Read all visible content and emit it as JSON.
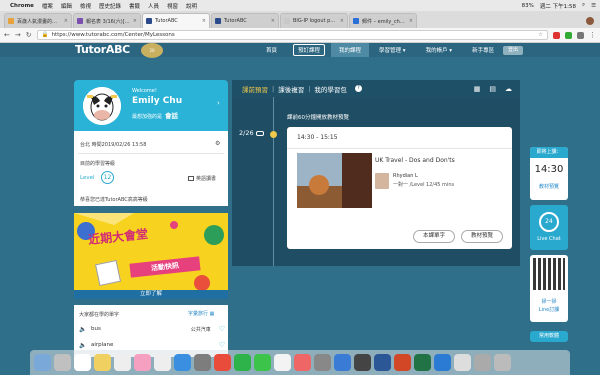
{
  "mac_menu": {
    "app": "Chrome",
    "items": [
      "檔案",
      "編輯",
      "檢視",
      "歷史記錄",
      "書籤",
      "人員",
      "視窗",
      "說明"
    ],
    "battery": "83%",
    "time": "週二 下午1:58"
  },
  "browser": {
    "tabs": [
      {
        "title": "百歲人氣漫畫的大崩拼：近",
        "color": "#e8a23c",
        "active": false
      },
      {
        "title": "報名表 3/16(六)[台北] 創心",
        "color": "#7a4fb0",
        "active": false
      },
      {
        "title": "TutorABC",
        "color": "#2a4a8c",
        "active": true
      },
      {
        "title": "TutorABC",
        "color": "#2a4a8c",
        "active": false
      },
      {
        "title": "BIG-IP logout page",
        "color": "#c8c8c8",
        "active": false
      },
      {
        "title": "郵件 – emily_chu@cathay",
        "color": "#2a6fd8",
        "active": false
      }
    ],
    "url": "https://www.tutorabc.com/Center/MyLessons"
  },
  "site": {
    "logo": "TutorABC",
    "nav": [
      {
        "label": "首頁",
        "style": "plain"
      },
      {
        "label": "預訂課程",
        "style": "boxed"
      },
      {
        "label": "我的課程",
        "style": "active"
      },
      {
        "label": "學習管理 ▾",
        "style": "plain"
      },
      {
        "label": "我的帳戶 ▾",
        "style": "plain"
      },
      {
        "label": "新手專區",
        "style": "plain"
      }
    ],
    "logout": "登出"
  },
  "profile": {
    "welcome": "Welcome!",
    "name": "Emily Chu",
    "fav_prefix": "最想加強的是",
    "fav_value": "會話",
    "time_zone": "台北 時間2019/02/26 13:58",
    "level_label_text": "目前的學習等級",
    "level_label": "Level",
    "level_value": "12",
    "english_test": "英語讀書",
    "congrats": "恭喜您已達TutorABC高高等級"
  },
  "banner": {
    "title": "近期大會堂",
    "subtitle": "活動快訊",
    "cta": "立即了解"
  },
  "vocab": {
    "title": "大家都在學的單字",
    "link": "字彙旅行",
    "words": [
      {
        "word": "bus",
        "translation": "公共汽車"
      },
      {
        "word": "airplane",
        "translation": ""
      }
    ]
  },
  "main": {
    "tabs": [
      "課前預習",
      "課後複習",
      "我的學習包"
    ],
    "hint": "課前60分鐘開放教材預覽",
    "date": "2/26",
    "lesson": {
      "time": "14:30 - 15:15",
      "title": "UK Travel - Dos and Don'ts",
      "teacher": "Rhydian L",
      "detail": "一對一 /Level 12/45 mins",
      "btn_vocab": "本課單字",
      "btn_preview": "教材預覽"
    }
  },
  "side": {
    "next_class_label": "即將上課：",
    "next_class_time": "14:30",
    "preview_link": "教材預覽",
    "live_chat": "Live Chat",
    "line_line1": "掃一掃",
    "line_line2": "Line訂課",
    "faq": "常用軟體"
  },
  "colors": {
    "brand": "#2aa9cf",
    "panel": "#1f4d63",
    "accent": "#f0c84a"
  }
}
